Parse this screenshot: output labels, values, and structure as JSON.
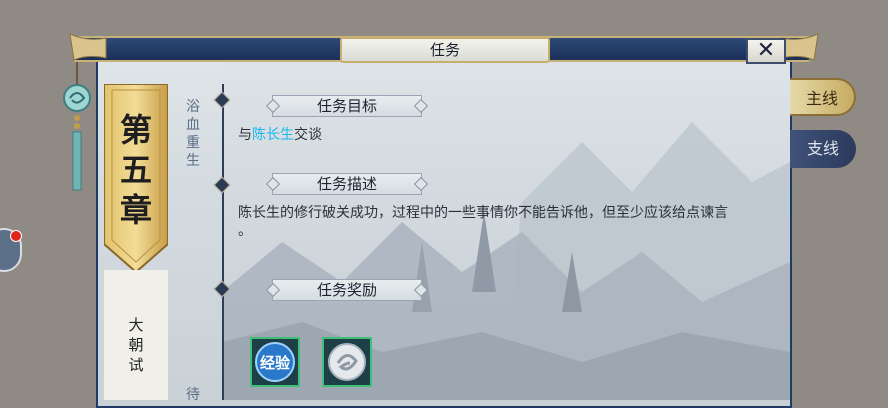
{
  "window": {
    "title": "任务",
    "close_label": "✕"
  },
  "chapter": {
    "number_chars": [
      "第",
      "五",
      "章"
    ],
    "name": "大朝试"
  },
  "quest_list": [
    {
      "label": "浴血重生"
    },
    {
      "label": "待"
    }
  ],
  "sections": {
    "goal": {
      "title": "任务目标",
      "prefix": "与",
      "npc": "陈长生",
      "suffix": "交谈"
    },
    "desc": {
      "title": "任务描述",
      "line1": "陈长生的修行破关成功，过程中的一些事情你不能告诉他，但至少应该给点谏言",
      "line2": "。"
    },
    "reward": {
      "title": "任务奖励"
    }
  },
  "rewards": [
    {
      "name": "exp-reward-icon",
      "label": "经验"
    },
    {
      "name": "currency-reward-icon",
      "label": ""
    }
  ],
  "tabs": {
    "main": "主线",
    "side": "支线"
  },
  "colors": {
    "highlight": "#17b8f0",
    "frame": "#1f3a64",
    "gold": "#c9b27a",
    "reward_border": "#3fbf77"
  }
}
